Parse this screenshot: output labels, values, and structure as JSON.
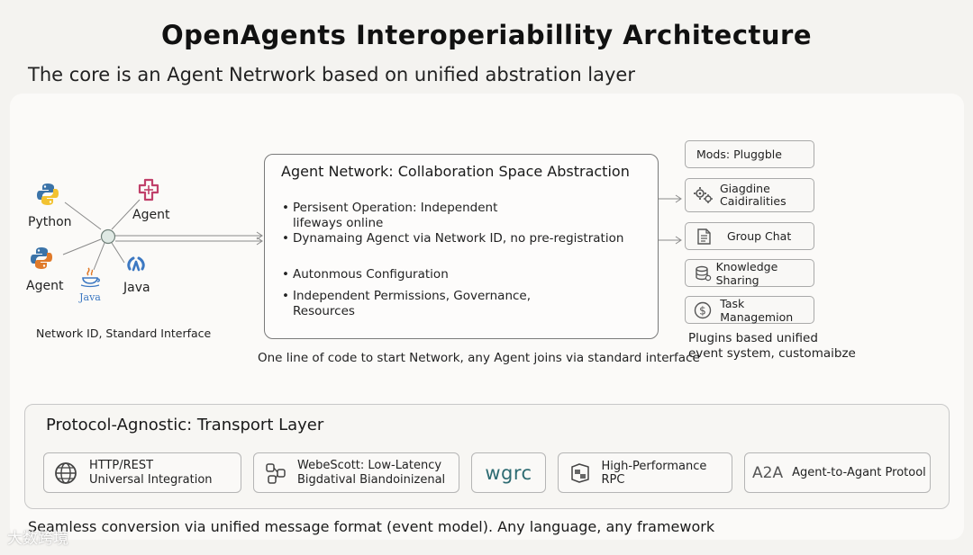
{
  "title": "OpenAgents Interoperiabillity Architecture",
  "subtitle": "The core is an Agent Netrwork based on unified abstration layer",
  "left": {
    "labels": {
      "python": "Python",
      "agent_top": "Agent",
      "agent_bottom": "Agent",
      "java": "Java",
      "java_logo_text": "Java"
    },
    "caption": "Network ID, Standard Interface"
  },
  "network": {
    "title": "Agent Network: Collaboration Space Abstraction",
    "bullets": [
      "Persisent Operation: Independent",
      "lifeways online",
      "Dynamaing Agenct via Network ID, no pre-registration",
      "Autonmous Configuration",
      "Independent Permissions, Governance,",
      "Resources"
    ],
    "caption": "One line of code to start Network, any Agent joins via standard interface"
  },
  "mods": {
    "header": "Mods: Pluggble",
    "items": [
      {
        "line1": "Giagdine",
        "line2": "Caidiralities",
        "icon": "gears-icon"
      },
      {
        "label": "Group Chat",
        "icon": "document-icon"
      },
      {
        "label": "Knowledge Sharing",
        "icon": "database-icon"
      },
      {
        "label": "Task Managemion",
        "icon": "dollar-icon"
      }
    ],
    "caption_line1": "Plugins based unified",
    "caption_line2": "event system, customaibze"
  },
  "transport": {
    "title": "Protocol-Agnostic: Transport Layer",
    "protocols": [
      {
        "line1": "HTTP/REST",
        "line2": "Universal Integration",
        "icon": "globe-icon"
      },
      {
        "line1": "WebeScott: Low-Latency",
        "line2": "Bigdatival Biandoinizenal",
        "icon": "nodes-icon"
      },
      {
        "logo": "wgrc",
        "icon": "grpc-logo"
      },
      {
        "line1": "High-Performance RPC",
        "icon": "server-icon"
      },
      {
        "logo": "A2A",
        "line1": "Agent-to-Agant Protool",
        "icon": "a2a-logo"
      }
    ]
  },
  "footer": "Seamless conversion via unified message format (event model). Any language, any framework",
  "watermark": "大数跨境",
  "colors": {
    "background": "#f4f3f0",
    "python_blue": "#3b73a8",
    "python_yellow": "#f2c230",
    "agent_pink": "#c0406a",
    "java_blue": "#3c78c2",
    "java_orange": "#e07a2a"
  }
}
